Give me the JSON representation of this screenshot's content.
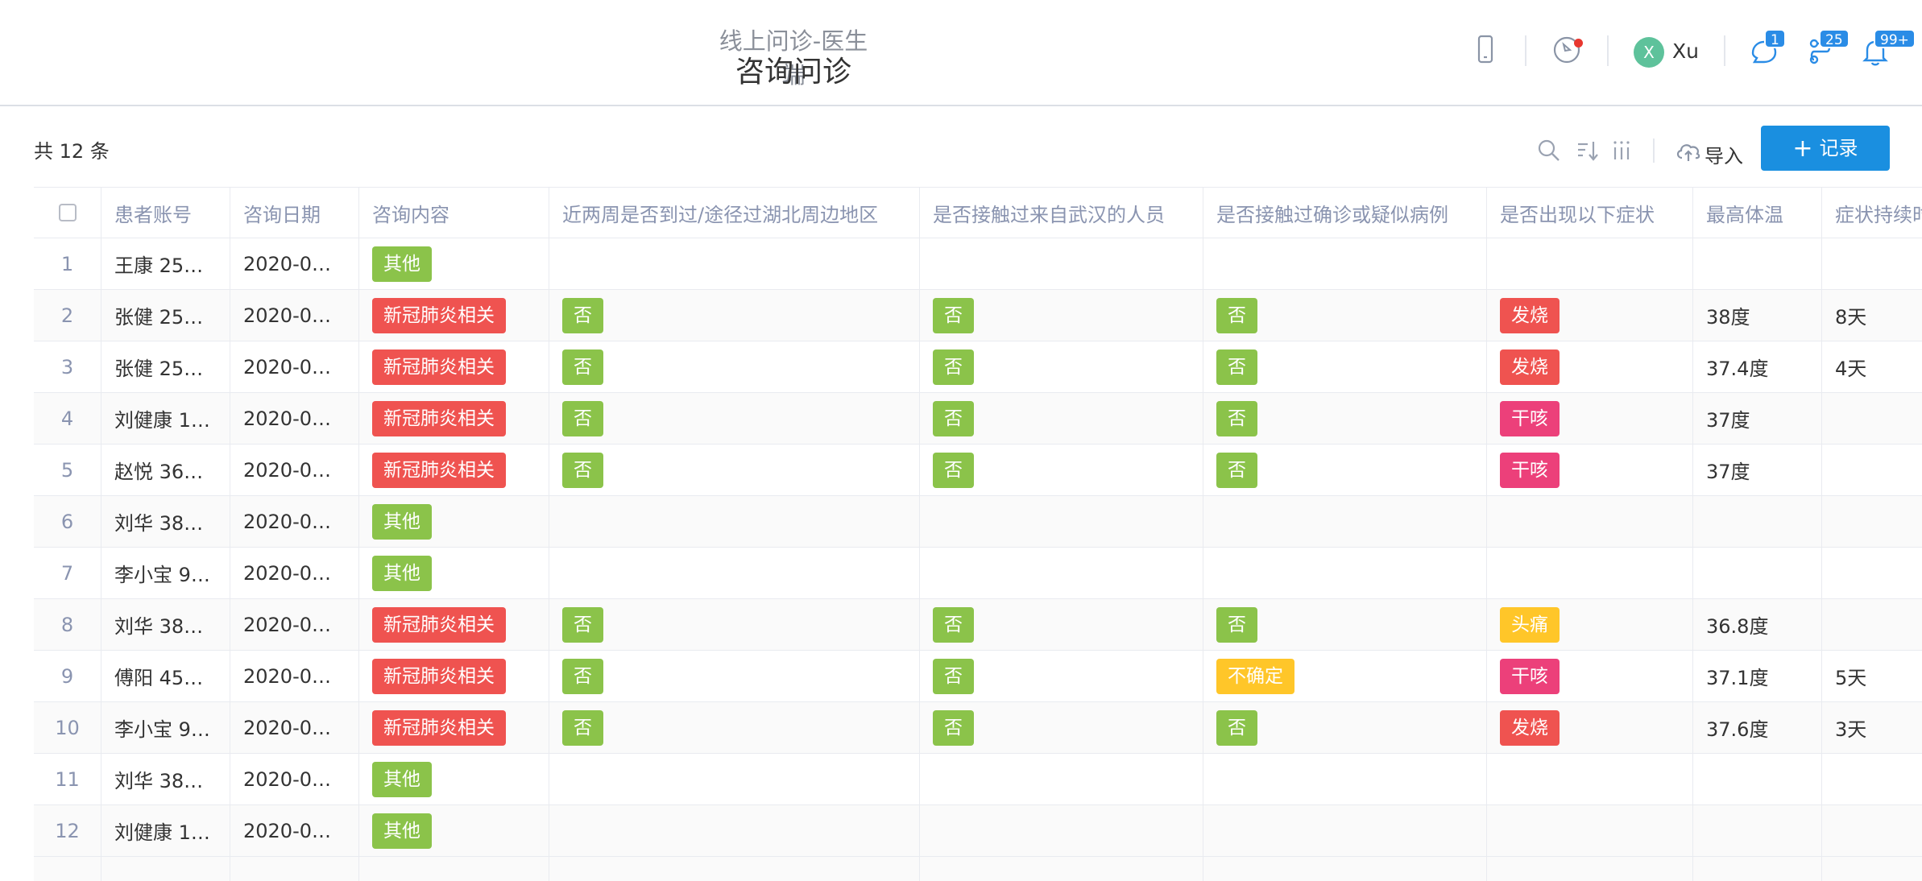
{
  "header": {
    "app_subtitle": "线上问诊-医生端",
    "page_title": "咨询问诊",
    "user_initial": "X",
    "user_name": "Xu",
    "badges": {
      "chat": "1",
      "flow": "25",
      "bell": "99+"
    }
  },
  "toolbar": {
    "count_text": "共 12 条",
    "import_label": "导入",
    "record_label": "记录",
    "record_plus": "+"
  },
  "colors": {
    "primary": "#1a8fe0",
    "tag_green": "#8bc34a",
    "tag_red": "#ef5350",
    "tag_pink": "#ec407a",
    "tag_yellow": "#ffc629"
  },
  "table": {
    "columns": [
      "患者账号",
      "咨询日期",
      "咨询内容",
      "近两周是否到过/途径过湖北周边地区",
      "是否接触过来自武汉的人员",
      "是否接触过确诊或疑似病例",
      "是否出现以下症状",
      "最高体温",
      "症状持续时"
    ],
    "rows": [
      {
        "no": "1",
        "account": "王康 25…",
        "date": "2020-0…",
        "content": "其他",
        "hubei": "",
        "wuhan": "",
        "contact": "",
        "symptom": "",
        "temp": "",
        "duration": ""
      },
      {
        "no": "2",
        "account": "张健 25…",
        "date": "2020-0…",
        "content": "新冠肺炎相关",
        "hubei": "否",
        "wuhan": "否",
        "contact": "否",
        "symptom": "发烧",
        "temp": "38度",
        "duration": "8天"
      },
      {
        "no": "3",
        "account": "张健 25…",
        "date": "2020-0…",
        "content": "新冠肺炎相关",
        "hubei": "否",
        "wuhan": "否",
        "contact": "否",
        "symptom": "发烧",
        "temp": "37.4度",
        "duration": "4天"
      },
      {
        "no": "4",
        "account": "刘健康 1…",
        "date": "2020-0…",
        "content": "新冠肺炎相关",
        "hubei": "否",
        "wuhan": "否",
        "contact": "否",
        "symptom": "干咳",
        "temp": "37度",
        "duration": ""
      },
      {
        "no": "5",
        "account": "赵悦 36…",
        "date": "2020-0…",
        "content": "新冠肺炎相关",
        "hubei": "否",
        "wuhan": "否",
        "contact": "否",
        "symptom": "干咳",
        "temp": "37度",
        "duration": ""
      },
      {
        "no": "6",
        "account": "刘华 38…",
        "date": "2020-0…",
        "content": "其他",
        "hubei": "",
        "wuhan": "",
        "contact": "",
        "symptom": "",
        "temp": "",
        "duration": ""
      },
      {
        "no": "7",
        "account": "李小宝 9…",
        "date": "2020-0…",
        "content": "其他",
        "hubei": "",
        "wuhan": "",
        "contact": "",
        "symptom": "",
        "temp": "",
        "duration": ""
      },
      {
        "no": "8",
        "account": "刘华 38…",
        "date": "2020-0…",
        "content": "新冠肺炎相关",
        "hubei": "否",
        "wuhan": "否",
        "contact": "否",
        "symptom": "头痛",
        "temp": "36.8度",
        "duration": ""
      },
      {
        "no": "9",
        "account": "傅阳 45…",
        "date": "2020-0…",
        "content": "新冠肺炎相关",
        "hubei": "否",
        "wuhan": "否",
        "contact": "不确定",
        "symptom": "干咳",
        "temp": "37.1度",
        "duration": "5天"
      },
      {
        "no": "10",
        "account": "李小宝 9…",
        "date": "2020-0…",
        "content": "新冠肺炎相关",
        "hubei": "否",
        "wuhan": "否",
        "contact": "否",
        "symptom": "发烧",
        "temp": "37.6度",
        "duration": "3天"
      },
      {
        "no": "11",
        "account": "刘华 38…",
        "date": "2020-0…",
        "content": "其他",
        "hubei": "",
        "wuhan": "",
        "contact": "",
        "symptom": "",
        "temp": "",
        "duration": ""
      },
      {
        "no": "12",
        "account": "刘健康 1…",
        "date": "2020-0…",
        "content": "其他",
        "hubei": "",
        "wuhan": "",
        "contact": "",
        "symptom": "",
        "temp": "",
        "duration": ""
      }
    ]
  }
}
